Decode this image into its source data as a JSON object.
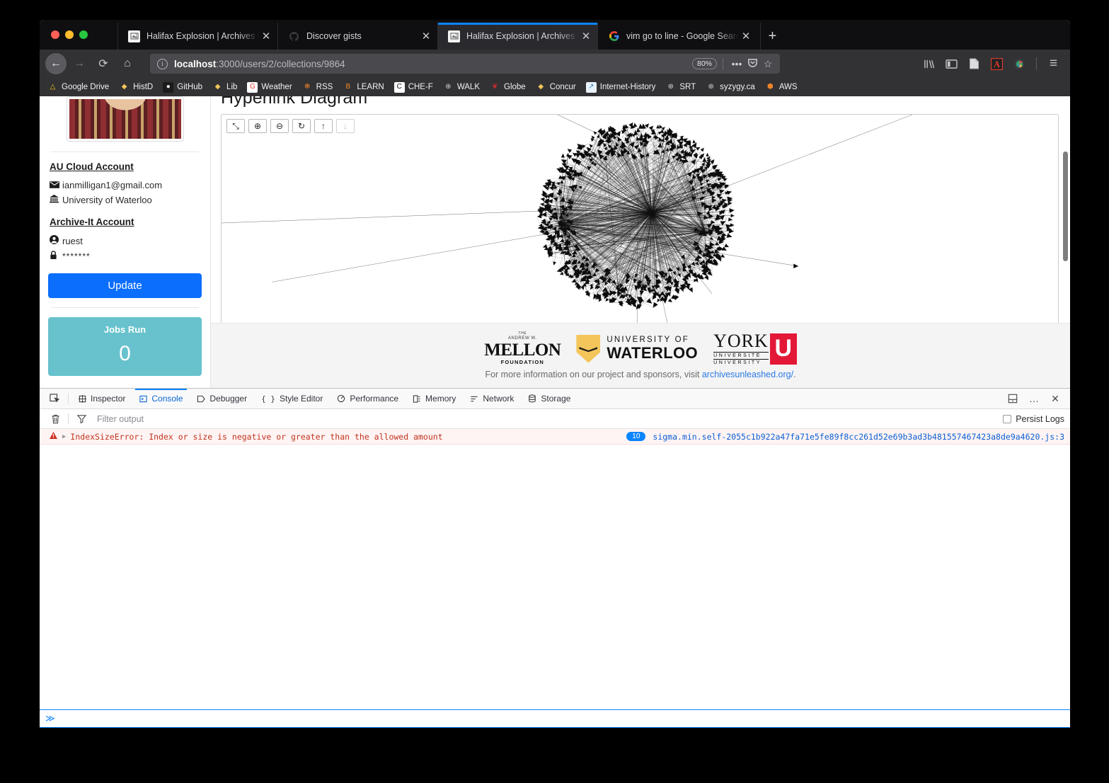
{
  "window": {
    "traffic_lights": [
      "close",
      "minimize",
      "zoom"
    ]
  },
  "tabs": [
    {
      "title": "Halifax Explosion | Archives Unl",
      "favicon": "archive-icon",
      "active": false,
      "close_label": "✕"
    },
    {
      "title": "Discover gists",
      "favicon": "github-icon",
      "active": false,
      "close_label": "✕"
    },
    {
      "title": "Halifax Explosion | Archives Unl",
      "favicon": "archive-icon",
      "active": true,
      "close_label": "✕"
    },
    {
      "title": "vim go to line - Google Search",
      "favicon": "google-icon",
      "active": false,
      "close_label": "✕"
    }
  ],
  "new_tab_label": "+",
  "nav": {
    "back_label": "←",
    "forward_label": "→",
    "reload_label": "⟳",
    "home_label": "⌂"
  },
  "url": {
    "info_label": "i",
    "host": "localhost",
    "path": ":3000/users/2/collections/9864",
    "zoom_level": "80%",
    "page_actions_label": "•••",
    "pocket_label": "▼",
    "bookmark_label": "☆"
  },
  "chrome_right": {
    "library_label": "‖∖",
    "sidebar_label": "◫",
    "reader_label": "▧",
    "acrobat_label": "A",
    "extension_label": "◉",
    "menu_label": "≡"
  },
  "bookmarks": [
    {
      "label": "Google Drive",
      "icon": "google-drive-icon",
      "glyph": "△",
      "color": "#f5c518",
      "bg": "transparent"
    },
    {
      "label": "HistD",
      "icon": "waterloo-shield-icon",
      "glyph": "◆",
      "color": "#f3c55a",
      "bg": "transparent"
    },
    {
      "label": "GitHub",
      "icon": "github-icon",
      "glyph": "●",
      "color": "#eeeeee",
      "bg": "#1b1b1b"
    },
    {
      "label": "Lib",
      "icon": "waterloo-shield-icon",
      "glyph": "◆",
      "color": "#f3c55a",
      "bg": "transparent"
    },
    {
      "label": "Weather",
      "icon": "google-icon",
      "glyph": "G",
      "color": "#ea4335",
      "bg": "#ffffff"
    },
    {
      "label": "RSS",
      "icon": "rss-icon",
      "glyph": "✻",
      "color": "#f0842c",
      "bg": "transparent"
    },
    {
      "label": "LEARN",
      "icon": "learn-icon",
      "glyph": "B",
      "color": "#f0842c",
      "bg": "transparent"
    },
    {
      "label": "CHE-F",
      "icon": "letter-c-icon",
      "glyph": "C",
      "color": "#111111",
      "bg": "#ffffff"
    },
    {
      "label": "WALK",
      "icon": "globe-icon",
      "glyph": "⊕",
      "color": "#cfcfcf",
      "bg": "transparent"
    },
    {
      "label": "Globe",
      "icon": "maple-leaf-icon",
      "glyph": "❦",
      "color": "#d42b2b",
      "bg": "transparent"
    },
    {
      "label": "Concur",
      "icon": "waterloo-shield-icon",
      "glyph": "◆",
      "color": "#f3c55a",
      "bg": "transparent"
    },
    {
      "label": "Internet-History",
      "icon": "chart-icon",
      "glyph": "↗",
      "color": "#2b7fc4",
      "bg": "#eaf2fb"
    },
    {
      "label": "SRT",
      "icon": "globe-icon",
      "glyph": "⊕",
      "color": "#cfcfcf",
      "bg": "transparent"
    },
    {
      "label": "syzygy.ca",
      "icon": "globe-icon",
      "glyph": "⊕",
      "color": "#cfcfcf",
      "bg": "transparent"
    },
    {
      "label": "AWS",
      "icon": "aws-icon",
      "glyph": "⬢",
      "color": "#f0842c",
      "bg": "transparent"
    }
  ],
  "sidebar": {
    "avatar_alt": "profile-photo",
    "au_cloud_heading": "AU Cloud Account",
    "email": "ianmilligan1@gmail.com",
    "institution": "University of Waterloo",
    "archive_it_heading": "Archive-It Account",
    "username": "ruest",
    "password_masked": "*******",
    "update_button": "Update",
    "jobs_title": "Jobs Run",
    "jobs_count": "0",
    "icons": {
      "email": "envelope-icon",
      "institution": "bank-icon",
      "user": "user-circle-icon",
      "password": "lock-icon"
    }
  },
  "main": {
    "title": "Hyperlink Diagram",
    "toolbar": [
      {
        "name": "fullscreen-button",
        "glyph": "⤡",
        "disabled": false
      },
      {
        "name": "zoom-in-button",
        "glyph": "⊕",
        "disabled": false
      },
      {
        "name": "zoom-out-button",
        "glyph": "⊖",
        "disabled": false
      },
      {
        "name": "reset-button",
        "glyph": "↻",
        "disabled": false
      },
      {
        "name": "upload-button",
        "glyph": "↑",
        "disabled": false
      },
      {
        "name": "download-button",
        "glyph": "↓",
        "disabled": true
      }
    ]
  },
  "footer": {
    "mellon": {
      "line1": "THE",
      "line2": "ANDREW W.",
      "line3": "MELLON",
      "line4": "FOUNDATION"
    },
    "waterloo": {
      "line1": "UNIVERSITY OF",
      "line2": "WATERLOO"
    },
    "york": {
      "line1": "YORK",
      "line2": "UNIVERSITÉ",
      "line3": "UNIVERSITY",
      "mark": "U"
    },
    "note_prefix": "For more information on our project and sponsors, visit ",
    "note_link": "archivesunleashed.org/",
    "note_suffix": "."
  },
  "devtools": {
    "picker_icon": "element-picker-icon",
    "tabs": [
      {
        "label": "Inspector",
        "icon": "inspector-icon",
        "active": false
      },
      {
        "label": "Console",
        "icon": "console-icon",
        "active": true
      },
      {
        "label": "Debugger",
        "icon": "debugger-icon",
        "active": false
      },
      {
        "label": "Style Editor",
        "icon": "style-editor-icon",
        "active": false
      },
      {
        "label": "Performance",
        "icon": "performance-icon",
        "active": false
      },
      {
        "label": "Memory",
        "icon": "memory-icon",
        "active": false
      },
      {
        "label": "Network",
        "icon": "network-icon",
        "active": false
      },
      {
        "label": "Storage",
        "icon": "storage-icon",
        "active": false
      }
    ],
    "right_buttons": [
      {
        "name": "dock-bottom-button",
        "glyph": "□"
      },
      {
        "name": "more-options-button",
        "glyph": "…"
      },
      {
        "name": "close-devtools-button",
        "glyph": "✕"
      }
    ],
    "filter": {
      "trash_icon": "trash-icon",
      "funnel_icon": "funnel-icon",
      "placeholder": "Filter output",
      "value": "",
      "persist_label": "Persist Logs",
      "persist_checked": false
    },
    "logs": [
      {
        "level": "error",
        "warn_icon": "warning-triangle-icon",
        "expander": "▶",
        "message": "IndexSizeError: Index or size is negative or greater than the allowed amount",
        "count": "10",
        "source": "sigma.min.self-2055c1b922a47fa71e5fe89f8cc261d52e69b3ad3b481557467423a8de9a4620.js:3"
      }
    ],
    "prompt": "≫"
  },
  "colors": {
    "accent_blue": "#0a84ff",
    "update_button": "#0b6efd",
    "jobs_card": "#67c2cd",
    "error_text": "#c0341d",
    "error_bg": "#fff4f4",
    "link": "#2a7ae2"
  }
}
